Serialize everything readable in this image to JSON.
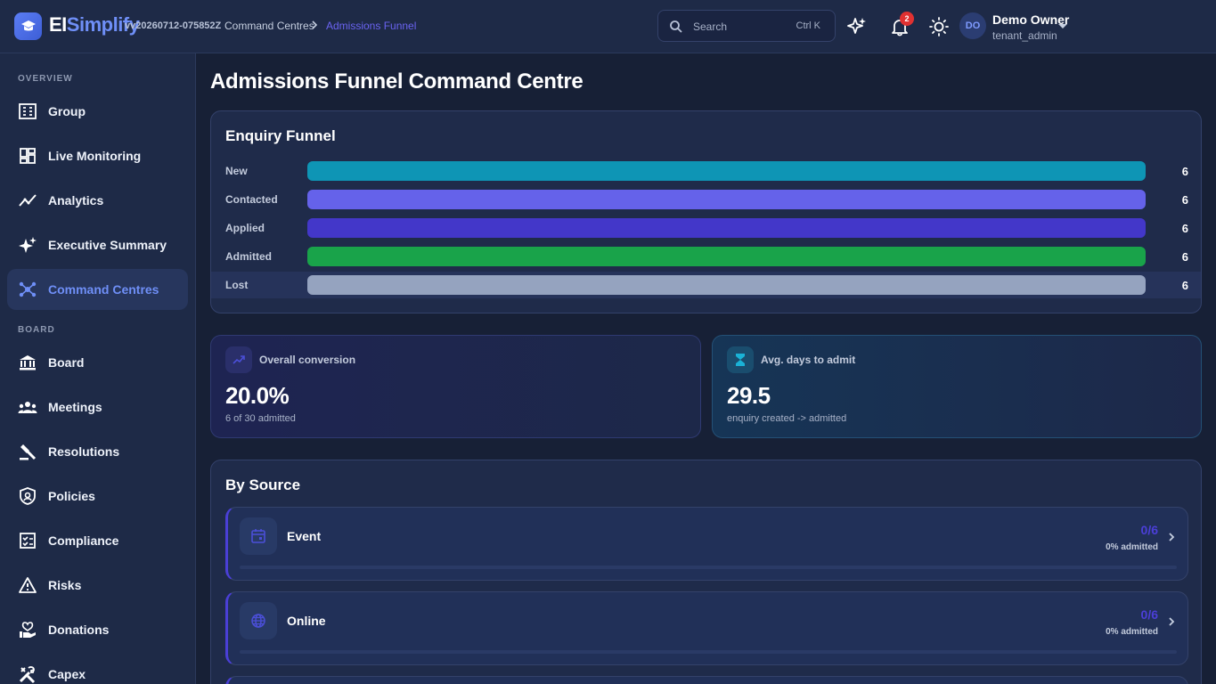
{
  "header": {
    "brand_part1": "EI",
    "brand_part2": "Simplify",
    "version": "vv20260712-075852Z",
    "breadcrumb": [
      "Command Centres",
      "Admissions Funnel"
    ],
    "search_placeholder": "Search",
    "search_shortcut": "Ctrl K",
    "notifications_count": "2",
    "user": {
      "initials": "DO",
      "name": "Demo Owner",
      "role": "tenant_admin"
    }
  },
  "sidebar": {
    "sections": [
      {
        "label": "OVERVIEW"
      },
      {
        "label": "BOARD"
      }
    ],
    "items": [
      {
        "label": "Group",
        "icon": "building-icon"
      },
      {
        "label": "Live Monitoring",
        "icon": "dashboard-icon"
      },
      {
        "label": "Analytics",
        "icon": "analytics-icon"
      },
      {
        "label": "Executive Summary",
        "icon": "sparkle-icon"
      },
      {
        "label": "Command Centres",
        "icon": "hub-icon",
        "active": true
      },
      {
        "label": "Board",
        "icon": "bank-icon"
      },
      {
        "label": "Meetings",
        "icon": "group-icon"
      },
      {
        "label": "Resolutions",
        "icon": "gavel-icon"
      },
      {
        "label": "Policies",
        "icon": "shield-icon"
      },
      {
        "label": "Compliance",
        "icon": "checklist-icon"
      },
      {
        "label": "Risks",
        "icon": "warning-icon"
      },
      {
        "label": "Donations",
        "icon": "heart-hand-icon"
      },
      {
        "label": "Capex",
        "icon": "tools-icon"
      }
    ]
  },
  "main": {
    "title": "Admissions Funnel Command Centre",
    "funnel": {
      "title": "Enquiry Funnel",
      "stages": [
        {
          "label": "New",
          "value": "6",
          "fraction": 1.0,
          "color": "#0e95b5"
        },
        {
          "label": "Contacted",
          "value": "6",
          "fraction": 1.0,
          "color": "#6562ea"
        },
        {
          "label": "Applied",
          "value": "6",
          "fraction": 1.0,
          "color": "#4337c9"
        },
        {
          "label": "Admitted",
          "value": "6",
          "fraction": 1.0,
          "color": "#19a34a"
        },
        {
          "label": "Lost",
          "value": "6",
          "fraction": 1.0,
          "color": "#95a3bf"
        }
      ]
    },
    "stats": [
      {
        "label": "Overall conversion",
        "value": "20.0%",
        "sub": "6 of 30 admitted",
        "icon": "trending-up-icon"
      },
      {
        "label": "Avg. days to admit",
        "value": "29.5",
        "sub": "enquiry created -> admitted",
        "icon": "hourglass-icon"
      }
    ],
    "by_source": {
      "title": "By Source",
      "items": [
        {
          "name": "Event",
          "ratio": "0/6",
          "pct": "0% admitted",
          "fraction": 0,
          "icon": "calendar-icon"
        },
        {
          "name": "Online",
          "ratio": "0/6",
          "pct": "0% admitted",
          "fraction": 0,
          "icon": "globe-icon"
        }
      ]
    }
  }
}
